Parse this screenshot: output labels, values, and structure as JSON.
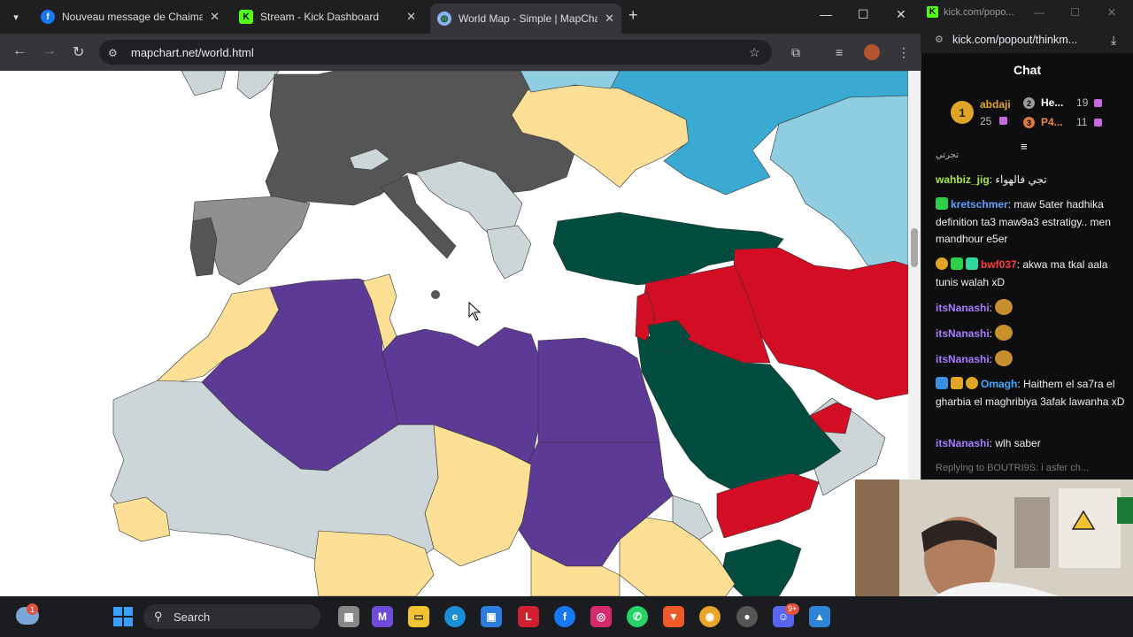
{
  "browser": {
    "tabs": [
      {
        "title": "Nouveau message de Chaima c",
        "favicon": "facebook-icon",
        "color": "#1877f2"
      },
      {
        "title": "Stream - Kick Dashboard",
        "favicon": "kick-icon",
        "color": "#53fc18"
      },
      {
        "title": "World Map - Simple | MapChart",
        "favicon": "globe-icon",
        "color": "#8ab4f8"
      }
    ],
    "url": "mapchart.net/world.html"
  },
  "map": {
    "colors": {
      "purple": "#5e3a97",
      "teal": "#004d40",
      "red": "#d20d24",
      "yellow": "#fddf95",
      "lightgray": "#ccd6d9",
      "darkgray": "#555555",
      "midgray": "#8f8f8f",
      "cyan": "#3aaad3",
      "lightcyan": "#8fcde0"
    }
  },
  "chat_window": {
    "domain": "kick.com/popo...",
    "url": "kick.com/popout/thinkm...",
    "header": "Chat",
    "leaderboard": [
      {
        "rank": "1",
        "name": "abdaji",
        "count": "25"
      },
      {
        "rank": "2",
        "name": "He...",
        "count": "19"
      },
      {
        "rank": "3",
        "name": "P4...",
        "count": "11"
      }
    ],
    "messages": [
      {
        "user": "",
        "text": "تجرتي",
        "color": "#efefef"
      },
      {
        "user": "wahbiz_jig",
        "text": "تجي فالهواء",
        "color": "#a5e84a"
      },
      {
        "user": "kretschmer",
        "text": "maw 5ater hadhika definition ta3 maw9a3 estratigy.. men mandhour e5er",
        "color": "#5aa0ff"
      },
      {
        "user": "bwf037",
        "text": "akwa ma tkal aala tunis walah xD",
        "color": "#ff3b3b"
      },
      {
        "user": "itsNanashi",
        "text": "",
        "color": "#a77bff"
      },
      {
        "user": "itsNanashi",
        "text": "",
        "color": "#a77bff"
      },
      {
        "user": "itsNanashi",
        "text": "",
        "color": "#a77bff"
      },
      {
        "user": "Omagh",
        "text": "Haithem el sa7ra el gharbia el maghribiya 3afak lawanha xD",
        "color": "#3fa9ff"
      },
      {
        "user": "itsNanashi",
        "text": "wlh saber",
        "color": "#a77bff"
      }
    ],
    "reply_preview": "Replying to BOUTRI9S: i asfer ch..."
  },
  "taskbar": {
    "search_label": "Search",
    "weather_badge": "1",
    "notification_badge": "9+"
  }
}
